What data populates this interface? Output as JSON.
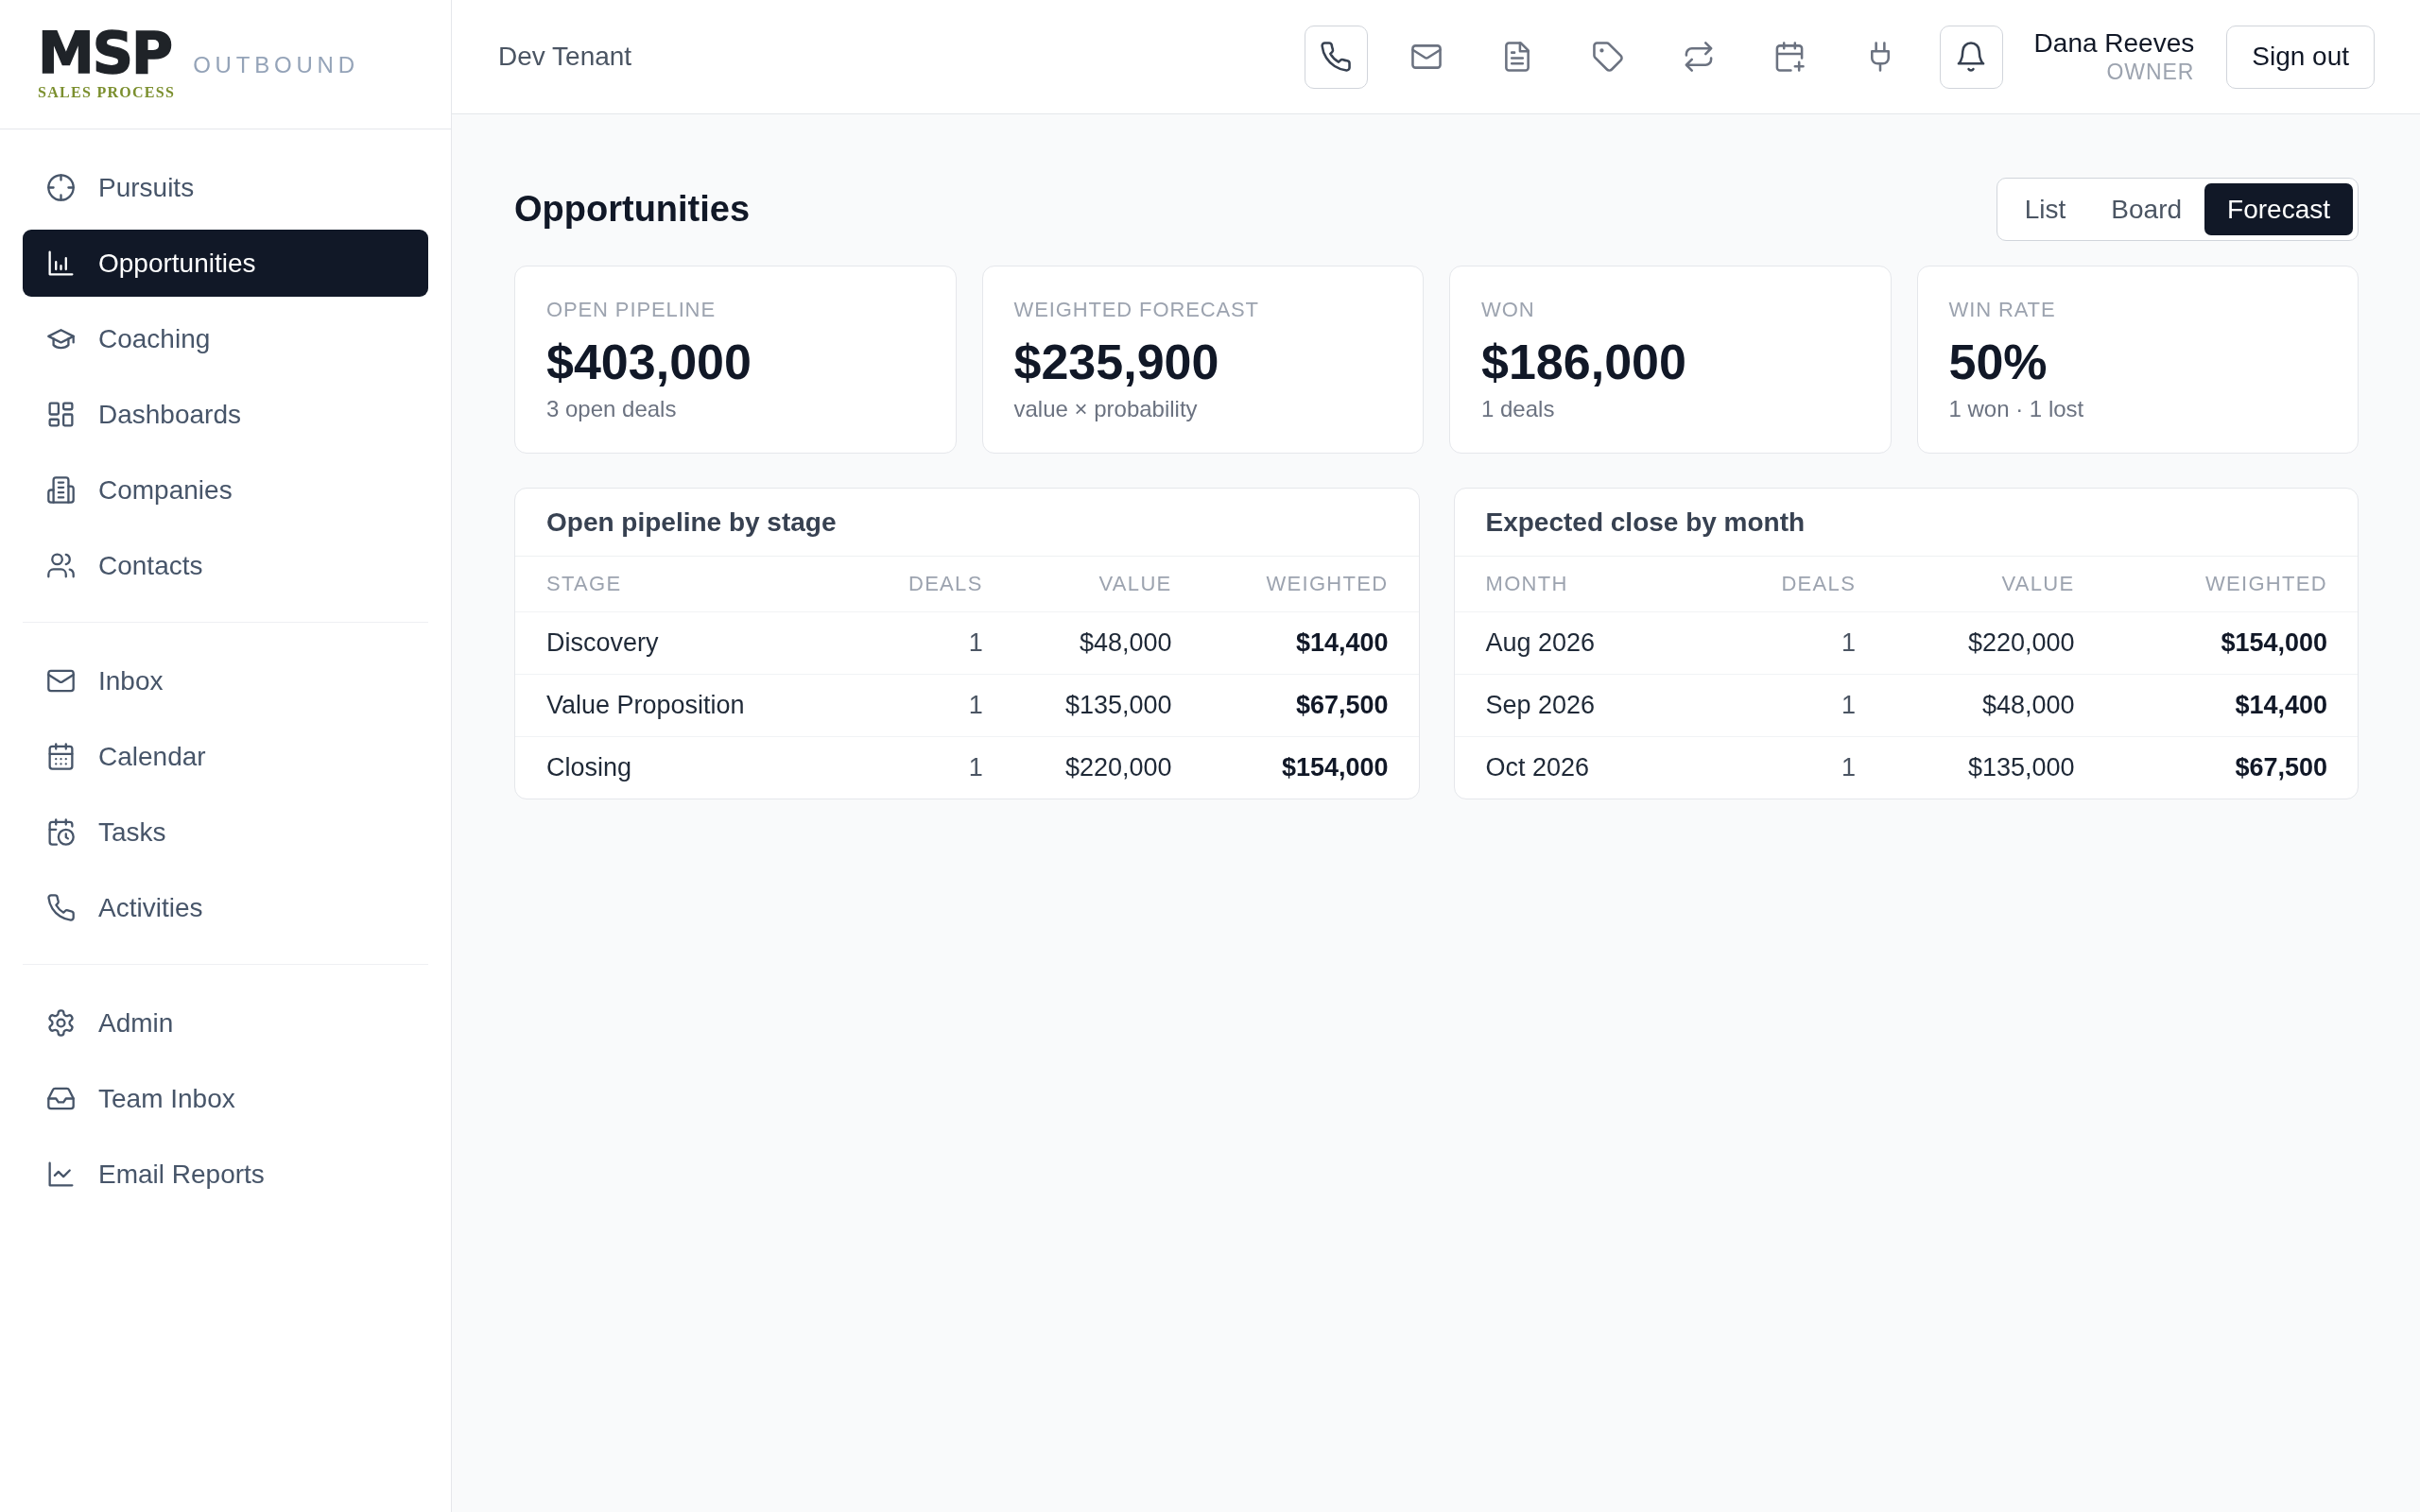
{
  "brand": {
    "wordmark": "MSP",
    "tagline": "SALES PROCESS",
    "product": "OUTBOUND"
  },
  "sidebar": {
    "sections": [
      {
        "items": [
          {
            "label": "Pursuits",
            "selected": false
          },
          {
            "label": "Opportunities",
            "selected": true
          },
          {
            "label": "Coaching",
            "selected": false
          },
          {
            "label": "Dashboards",
            "selected": false
          },
          {
            "label": "Companies",
            "selected": false
          },
          {
            "label": "Contacts",
            "selected": false
          }
        ]
      },
      {
        "items": [
          {
            "label": "Inbox",
            "selected": false
          },
          {
            "label": "Calendar",
            "selected": false
          },
          {
            "label": "Tasks",
            "selected": false
          },
          {
            "label": "Activities",
            "selected": false
          }
        ]
      },
      {
        "items": [
          {
            "label": "Admin",
            "selected": false
          },
          {
            "label": "Team Inbox",
            "selected": false
          },
          {
            "label": "Email Reports",
            "selected": false
          }
        ]
      }
    ]
  },
  "header": {
    "tenant": "Dev Tenant",
    "tools": [
      {
        "selected": true
      },
      {
        "selected": false
      },
      {
        "selected": false
      },
      {
        "selected": false
      },
      {
        "selected": false
      },
      {
        "selected": false
      },
      {
        "selected": false
      },
      {
        "selected": true
      }
    ],
    "user": {
      "name": "Dana Reeves",
      "role": "OWNER"
    },
    "sign_out": "Sign out"
  },
  "page": {
    "title": "Opportunities",
    "views": [
      {
        "label": "List",
        "selected": false
      },
      {
        "label": "Board",
        "selected": false
      },
      {
        "label": "Forecast",
        "selected": true
      }
    ]
  },
  "stats": [
    {
      "label": "OPEN PIPELINE",
      "value": "$403,000",
      "note": "3 open deals"
    },
    {
      "label": "WEIGHTED FORECAST",
      "value": "$235,900",
      "note": "value × probability"
    },
    {
      "label": "WON",
      "value": "$186,000",
      "note": "1 deals"
    },
    {
      "label": "WIN RATE",
      "value": "50%",
      "note": "1 won · 1 lost"
    }
  ],
  "tables": [
    {
      "title": "Open pipeline by stage",
      "columns": [
        "STAGE",
        "DEALS",
        "VALUE",
        "WEIGHTED"
      ],
      "rows": [
        [
          "Discovery",
          "1",
          "$48,000",
          "$14,400"
        ],
        [
          "Value Proposition",
          "1",
          "$135,000",
          "$67,500"
        ],
        [
          "Closing",
          "1",
          "$220,000",
          "$154,000"
        ]
      ]
    },
    {
      "title": "Expected close by month",
      "columns": [
        "MONTH",
        "DEALS",
        "VALUE",
        "WEIGHTED"
      ],
      "rows": [
        [
          "Aug 2026",
          "1",
          "$220,000",
          "$154,000"
        ],
        [
          "Sep 2026",
          "1",
          "$48,000",
          "$14,400"
        ],
        [
          "Oct 2026",
          "1",
          "$135,000",
          "$67,500"
        ]
      ]
    }
  ]
}
